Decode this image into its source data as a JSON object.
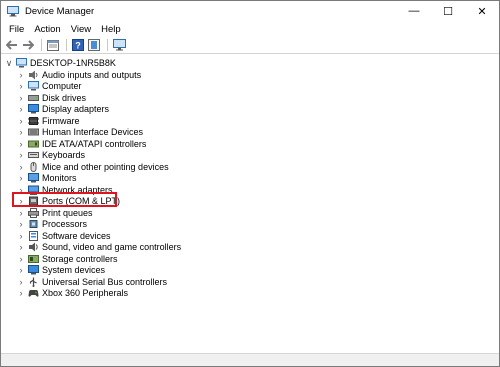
{
  "window": {
    "title": "Device Manager",
    "minimize_glyph": "—",
    "maximize_glyph": "☐",
    "close_glyph": "✕"
  },
  "menu": {
    "items": [
      "File",
      "Action",
      "View",
      "Help"
    ]
  },
  "toolbar": {
    "icons": [
      "back-arrow-icon",
      "forward-arrow-icon",
      "properties-icon",
      "help-icon",
      "update-driver-icon",
      "monitor-icon"
    ]
  },
  "tree": {
    "root": {
      "label": "DESKTOP-1NR5B8K",
      "icon": "computer-icon",
      "expanded": true
    },
    "items": [
      {
        "label": "Audio inputs and outputs",
        "icon": "speaker-icon"
      },
      {
        "label": "Computer",
        "icon": "computer-icon"
      },
      {
        "label": "Disk drives",
        "icon": "disk-drive-icon"
      },
      {
        "label": "Display adapters",
        "icon": "display-adapter-icon"
      },
      {
        "label": "Firmware",
        "icon": "firmware-icon"
      },
      {
        "label": "Human Interface Devices",
        "icon": "hid-icon"
      },
      {
        "label": "IDE ATA/ATAPI controllers",
        "icon": "ide-controller-icon"
      },
      {
        "label": "Keyboards",
        "icon": "keyboard-icon"
      },
      {
        "label": "Mice and other pointing devices",
        "icon": "mouse-icon"
      },
      {
        "label": "Monitors",
        "icon": "monitor-icon"
      },
      {
        "label": "Network adapters",
        "icon": "network-adapter-icon"
      },
      {
        "label": "Ports (COM & LPT)",
        "icon": "port-icon"
      },
      {
        "label": "Print queues",
        "icon": "printer-icon"
      },
      {
        "label": "Processors",
        "icon": "processor-icon"
      },
      {
        "label": "Software devices",
        "icon": "software-device-icon"
      },
      {
        "label": "Sound, video and game controllers",
        "icon": "sound-icon"
      },
      {
        "label": "Storage controllers",
        "icon": "storage-controller-icon"
      },
      {
        "label": "System devices",
        "icon": "system-device-icon"
      },
      {
        "label": "Universal Serial Bus controllers",
        "icon": "usb-icon"
      },
      {
        "label": "Xbox 360 Peripherals",
        "icon": "gamepad-icon"
      }
    ]
  },
  "colors": {
    "highlight_border": "#e0141e",
    "accent_blue": "#2f79c8"
  }
}
